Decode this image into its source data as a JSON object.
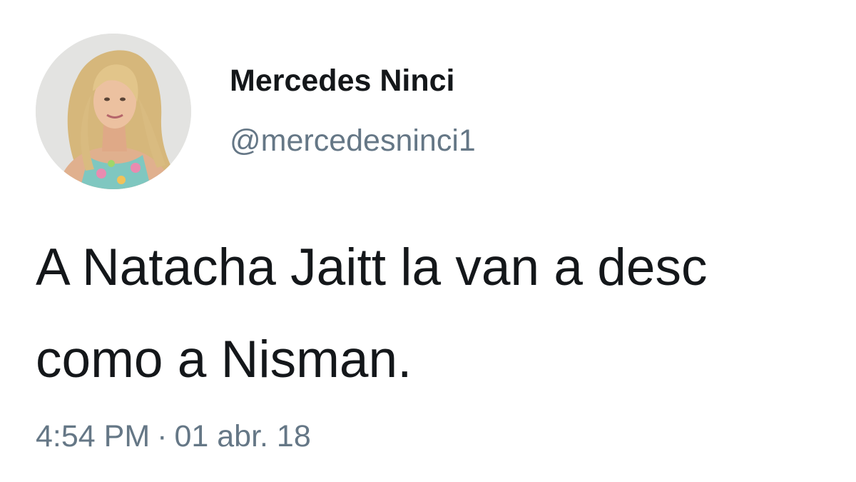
{
  "tweet": {
    "display_name": "Mercedes Ninci",
    "handle": "@mercedesninci1",
    "text_lines": [
      "A Natacha Jaitt la van a desc",
      "como a Nisman."
    ],
    "time": "4:54 PM",
    "separator": "·",
    "date": "01 abr. 18"
  },
  "colors": {
    "name_text": "#14171a",
    "secondary_text": "#657786",
    "background": "#ffffff"
  }
}
